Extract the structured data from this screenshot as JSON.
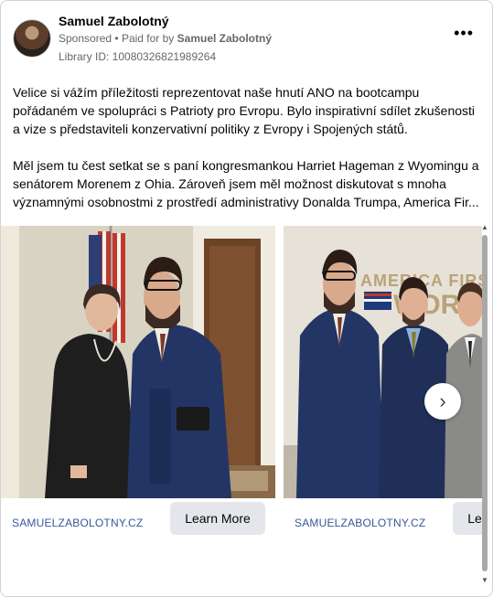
{
  "header": {
    "page_name": "Samuel Zabolotný",
    "sponsored": "Sponsored",
    "paid_for_prefix": "Paid for by",
    "paid_for_name": "Samuel Zabolotný",
    "library_id": "Library ID: 10080326821989264",
    "more_glyph": "•••"
  },
  "post": {
    "paragraph1": "Velice si vážím příležitosti reprezentovat naše hnutí ANO na bootcampu pořádaném ve spolupráci s Patrioty pro Evropu. Bylo inspirativní sdílet zkušenosti a vize s představiteli konzervativní politiky z Evropy i Spojených států.",
    "paragraph2_line1": "Měl jsem tu čest setkat se s paní kongresmankou Harriet Hageman z Wyomingu a senátorem Morenem z Ohia. Zároveň jsem měl možnost diskutovat s mnoha",
    "paragraph2_line2": "významnými osobnostmi z prostředí administrativy Donalda Trumpa, America Fir..."
  },
  "carousel": {
    "cards": [
      {
        "url": "SAMUELZABOLOTNY.CZ",
        "cta": "Learn More"
      },
      {
        "url": "SAMUELZABOLOTNY.CZ",
        "cta": "Learn More"
      }
    ],
    "next_glyph": "›",
    "wall_sign": "AMERICA FIRST WORKS"
  },
  "colors": {
    "link": "#385898",
    "cta_bg": "#e4e6eb",
    "secondary_text": "#65676b"
  }
}
